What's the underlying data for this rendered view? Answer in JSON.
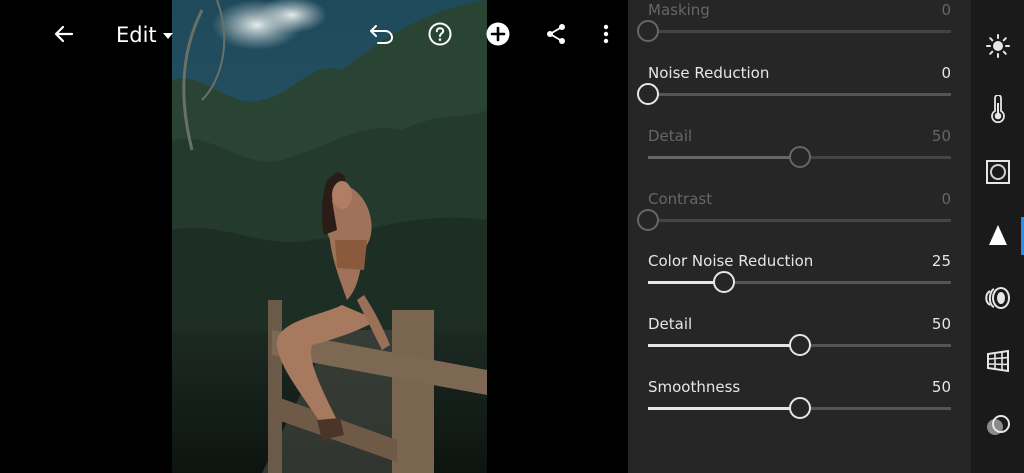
{
  "topbar": {
    "edit_label": "Edit",
    "icons": [
      "back-arrow-icon",
      "undo-icon",
      "help-icon",
      "add-icon",
      "share-icon",
      "more-icon"
    ]
  },
  "detail_panel": {
    "sliders": [
      {
        "label": "Masking",
        "value": "0",
        "level": 0,
        "enabled": false
      },
      {
        "label": "Noise Reduction",
        "value": "0",
        "level": 0,
        "enabled": true
      },
      {
        "label": "Detail",
        "value": "50",
        "level": 0.5,
        "enabled": false
      },
      {
        "label": "Contrast",
        "value": "0",
        "level": 0,
        "enabled": false
      },
      {
        "label": "Color Noise Reduction",
        "value": "25",
        "level": 0.25,
        "enabled": true
      },
      {
        "label": "Detail",
        "value": "50",
        "level": 0.5,
        "enabled": true
      },
      {
        "label": "Smoothness",
        "value": "50",
        "level": 0.5,
        "enabled": true
      }
    ]
  },
  "tool_rail": {
    "tools": [
      {
        "icon": "light-icon",
        "active": false
      },
      {
        "icon": "color-thermometer-icon",
        "active": false
      },
      {
        "icon": "effects-vignette-icon",
        "active": false
      },
      {
        "icon": "detail-triangle-icon",
        "active": true
      },
      {
        "icon": "optics-lens-icon",
        "active": false
      },
      {
        "icon": "geometry-grid-icon",
        "active": false
      },
      {
        "icon": "presets-circles-icon",
        "active": false
      }
    ],
    "accent_color": "#2d8ceb"
  }
}
